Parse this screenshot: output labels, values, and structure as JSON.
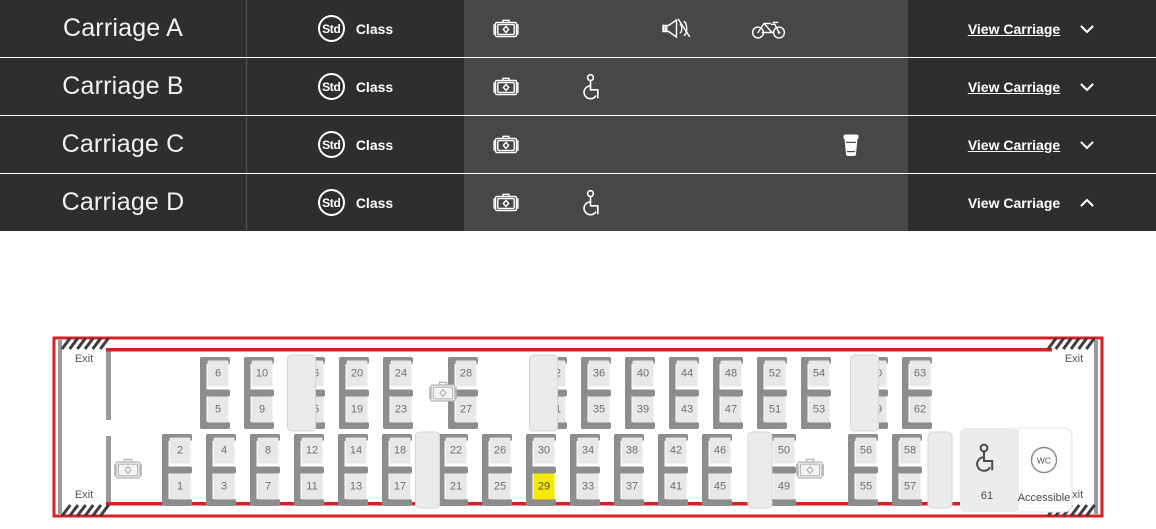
{
  "colors": {
    "row_bg": "#2e2e2e",
    "facilities_bg": "#474747",
    "divider": "#585858",
    "text_light": "#ffffff",
    "carriage_border": "#d81f26",
    "seat_frame": "#8d8d8d",
    "seat_fill": "#e8e8e8",
    "seat_number": "#6e6e6e",
    "selected_seat": "#f5ea00",
    "partition_fill": "#ebebeb",
    "wall_grey": "#9a9a9a"
  },
  "carriage_list": {
    "class_label": "Class",
    "class_badge": "Std",
    "view_label": "View Carriage",
    "rows": [
      {
        "name": "Carriage A",
        "class_badge": "Std",
        "class_label": "Class",
        "facilities": [
          {
            "slot": 0,
            "icon": "luggage-icon",
            "name": "luggage-rack"
          },
          {
            "slot": 2,
            "icon": "quiet-zone-icon",
            "name": "quiet-zone"
          },
          {
            "slot": 3,
            "icon": "bicycle-icon",
            "name": "bicycle-storage"
          }
        ],
        "view_label": "View Carriage",
        "expanded": false,
        "chevron": "chevron-down"
      },
      {
        "name": "Carriage B",
        "class_badge": "Std",
        "class_label": "Class",
        "facilities": [
          {
            "slot": 0,
            "icon": "luggage-icon",
            "name": "luggage-rack"
          },
          {
            "slot": 1,
            "icon": "wheelchair-icon",
            "name": "wheelchair-accessible"
          }
        ],
        "view_label": "View Carriage",
        "expanded": false,
        "chevron": "chevron-down"
      },
      {
        "name": "Carriage C",
        "class_badge": "Std",
        "class_label": "Class",
        "facilities": [
          {
            "slot": 0,
            "icon": "luggage-icon",
            "name": "luggage-rack"
          },
          {
            "slot": 4,
            "icon": "coffee-cup-icon",
            "name": "catering"
          }
        ],
        "view_label": "View Carriage",
        "expanded": false,
        "chevron": "chevron-down"
      },
      {
        "name": "Carriage D",
        "class_badge": "Std",
        "class_label": "Class",
        "facilities": [
          {
            "slot": 0,
            "icon": "luggage-icon",
            "name": "luggage-rack"
          },
          {
            "slot": 1,
            "icon": "wheelchair-icon",
            "name": "wheelchair-accessible"
          }
        ],
        "view_label": "View Carriage",
        "expanded": true,
        "chevron": "chevron-up"
      }
    ]
  },
  "seat_map": {
    "carriage": "Carriage D",
    "selected_seats": [
      29
    ],
    "exit_labels": [
      "Exit",
      "Exit",
      "Exit",
      "Exit"
    ],
    "accessible_seat": {
      "number": 61,
      "label": "Accessible",
      "wc_label": "WC"
    },
    "top_row": {
      "pairs": [
        {
          "upper": 6,
          "lower": 5
        },
        {
          "upper": 10,
          "lower": 9
        },
        {
          "upper": 16,
          "lower": 15
        },
        {
          "upper": 20,
          "lower": 19
        },
        {
          "upper": 24,
          "lower": 23
        },
        {
          "upper": 28,
          "lower": 27
        },
        {
          "upper": 32,
          "lower": 31
        },
        {
          "upper": 36,
          "lower": 35
        },
        {
          "upper": 40,
          "lower": 39
        },
        {
          "upper": 44,
          "lower": 43
        },
        {
          "upper": 48,
          "lower": 47
        },
        {
          "upper": 52,
          "lower": 51
        },
        {
          "upper": 54,
          "lower": 53
        },
        {
          "upper": 60,
          "lower": 59
        },
        {
          "upper": 63,
          "lower": 62
        }
      ],
      "luggage_racks": 1,
      "partitions": 3
    },
    "bottom_row": {
      "pairs": [
        {
          "upper": 2,
          "lower": 1
        },
        {
          "upper": 4,
          "lower": 3
        },
        {
          "upper": 8,
          "lower": 7
        },
        {
          "upper": 12,
          "lower": 11
        },
        {
          "upper": 14,
          "lower": 13
        },
        {
          "upper": 18,
          "lower": 17
        },
        {
          "upper": 22,
          "lower": 21
        },
        {
          "upper": 26,
          "lower": 25
        },
        {
          "upper": 30,
          "lower": 29
        },
        {
          "upper": 34,
          "lower": 33
        },
        {
          "upper": 38,
          "lower": 37
        },
        {
          "upper": 42,
          "lower": 41
        },
        {
          "upper": 46,
          "lower": 45
        },
        {
          "upper": 50,
          "lower": 49
        },
        {
          "upper": 56,
          "lower": 55
        },
        {
          "upper": 58,
          "lower": 57
        }
      ],
      "luggage_racks": 2,
      "partitions": 3
    }
  }
}
